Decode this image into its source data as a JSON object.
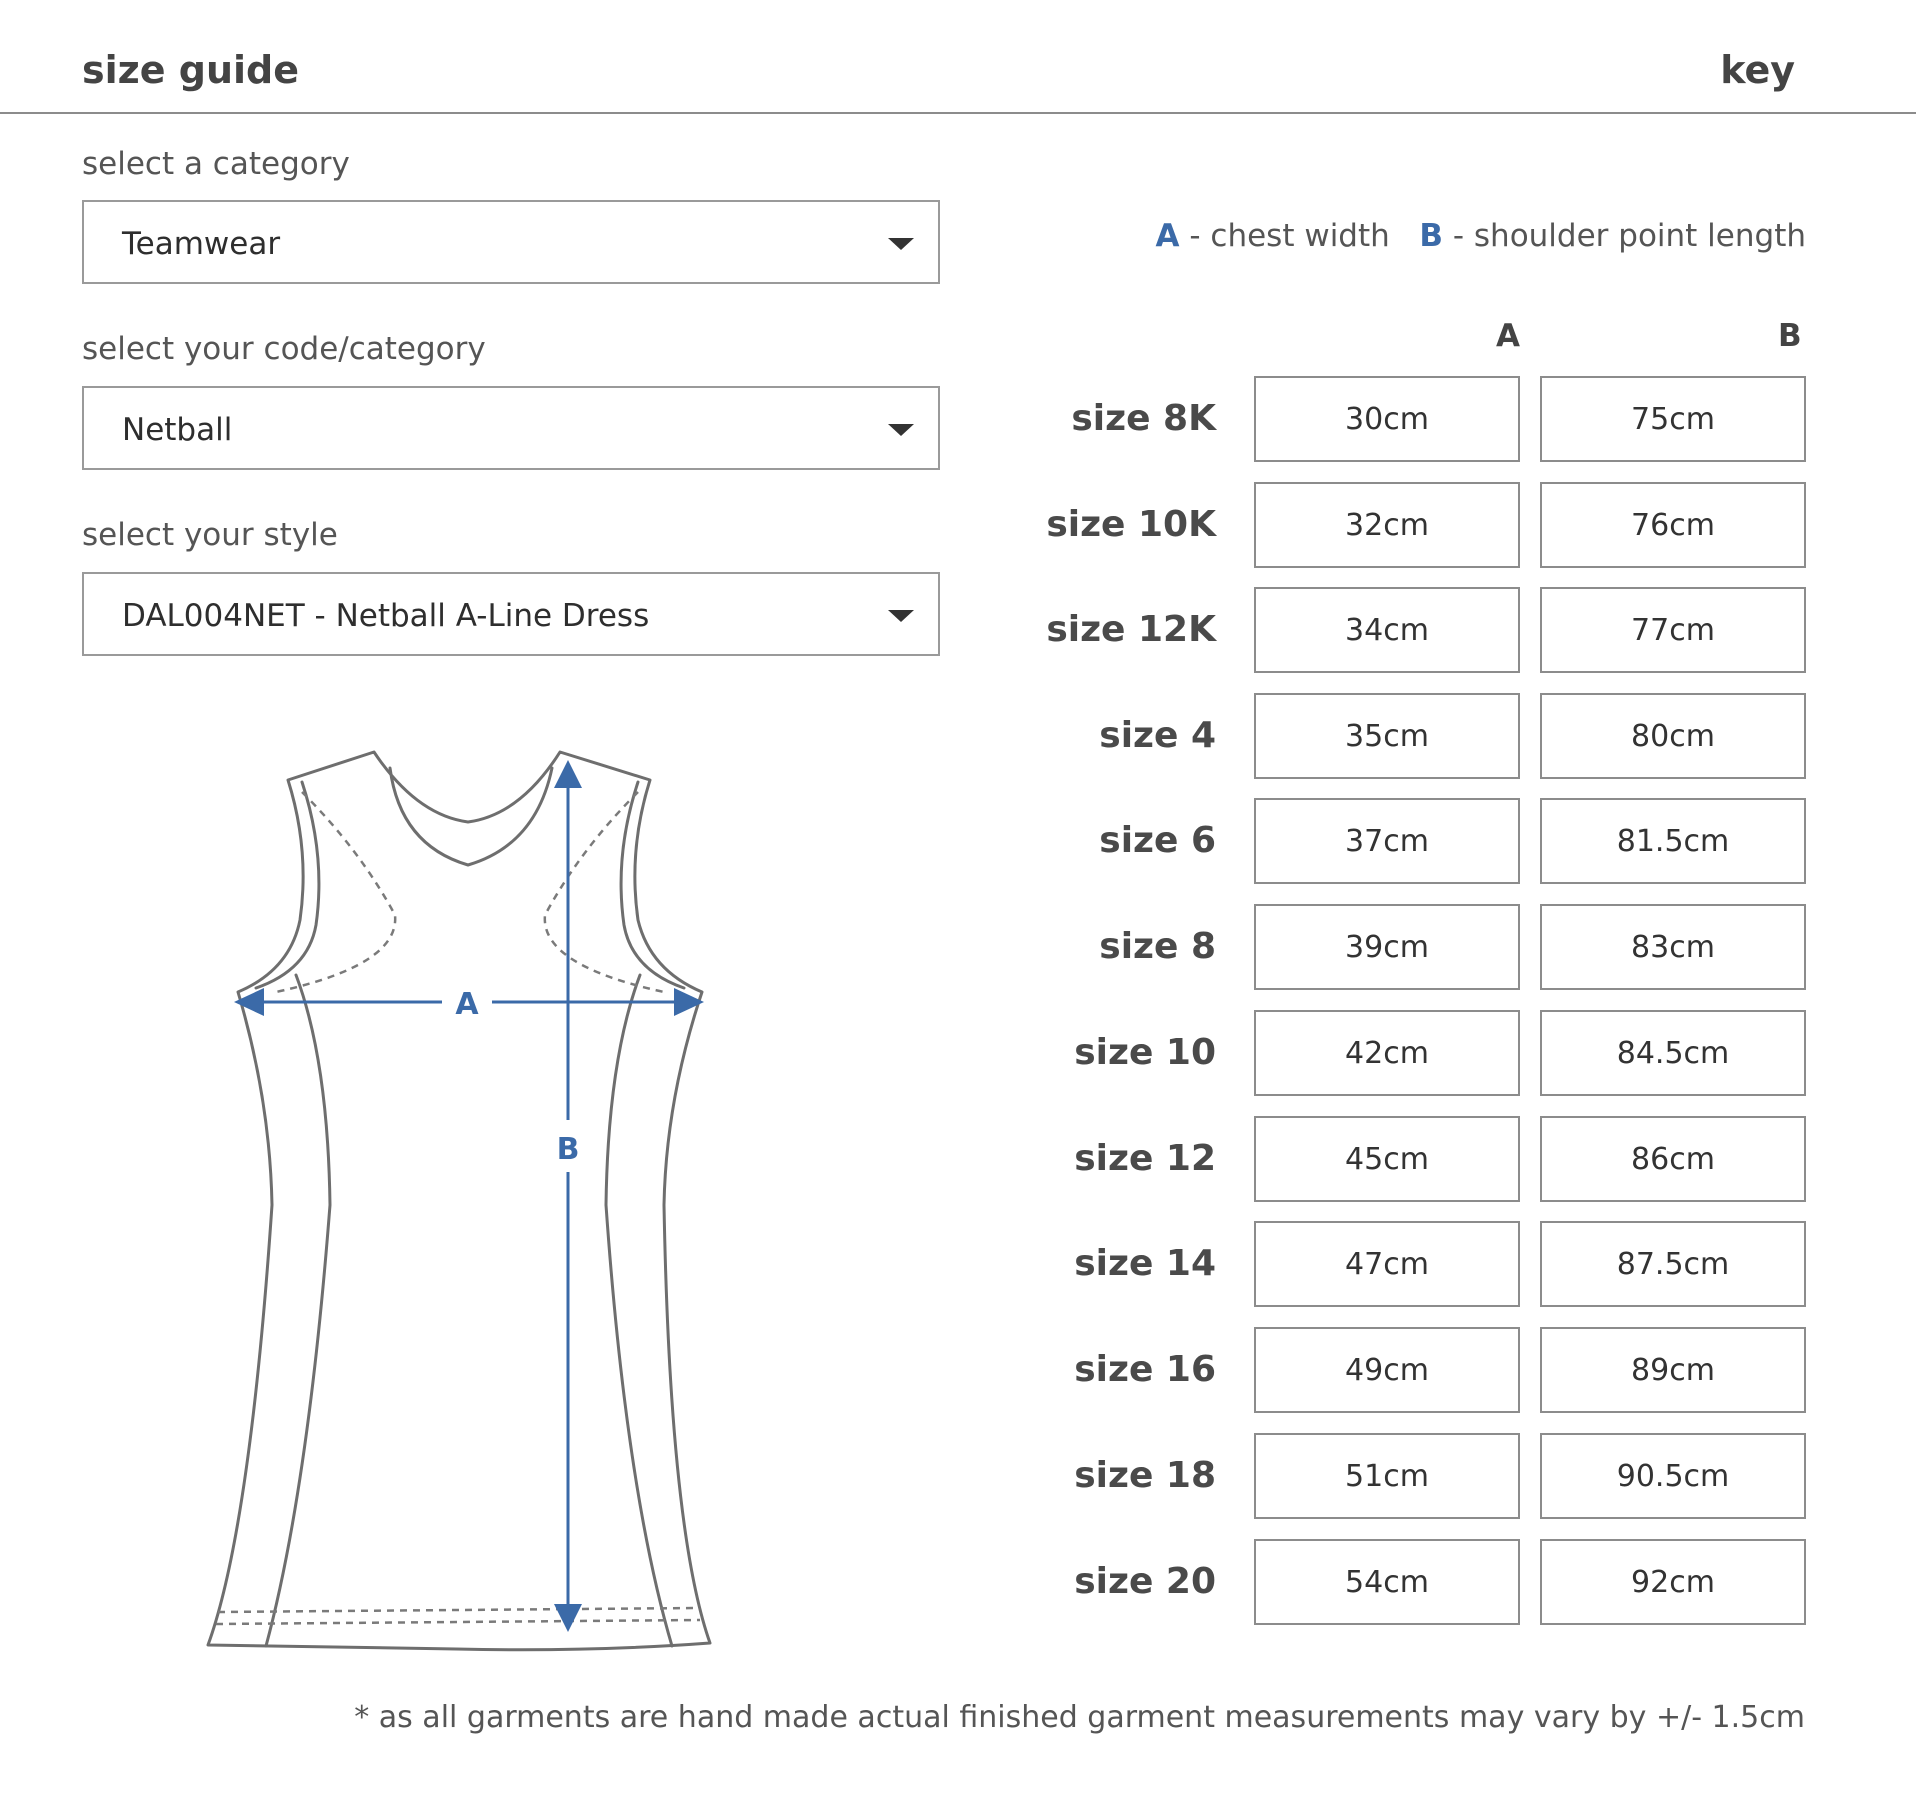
{
  "header": {
    "title": "size guide",
    "key_label": "key"
  },
  "selectors": [
    {
      "label": "select a category",
      "value": "Teamwear"
    },
    {
      "label": "select your code/category",
      "value": "Netball"
    },
    {
      "label": "select your style",
      "value": "DAL004NET - Netball A-Line Dress"
    }
  ],
  "key": {
    "a_letter": "A",
    "a_text": "- chest width",
    "b_letter": "B",
    "b_text": "- shoulder point length"
  },
  "table": {
    "columns": [
      "A",
      "B"
    ],
    "rows": [
      {
        "size": "size 8K",
        "a": "30cm",
        "b": "75cm"
      },
      {
        "size": "size 10K",
        "a": "32cm",
        "b": "76cm"
      },
      {
        "size": "size 12K",
        "a": "34cm",
        "b": "77cm"
      },
      {
        "size": "size 4",
        "a": "35cm",
        "b": "80cm"
      },
      {
        "size": "size 6",
        "a": "37cm",
        "b": "81.5cm"
      },
      {
        "size": "size 8",
        "a": "39cm",
        "b": "83cm"
      },
      {
        "size": "size 10",
        "a": "42cm",
        "b": "84.5cm"
      },
      {
        "size": "size 12",
        "a": "45cm",
        "b": "86cm"
      },
      {
        "size": "size 14",
        "a": "47cm",
        "b": "87.5cm"
      },
      {
        "size": "size 16",
        "a": "49cm",
        "b": "89cm"
      },
      {
        "size": "size 18",
        "a": "51cm",
        "b": "90.5cm"
      },
      {
        "size": "size 20",
        "a": "54cm",
        "b": "92cm"
      }
    ]
  },
  "diagram": {
    "label_a": "A",
    "label_b": "B"
  },
  "note": "* as all garments are hand made actual finished garment measurements may vary by +/- 1.5cm",
  "colors": {
    "accent": "#3b6aa8",
    "border": "#8c8c8c",
    "outline": "#6e6e6e"
  }
}
